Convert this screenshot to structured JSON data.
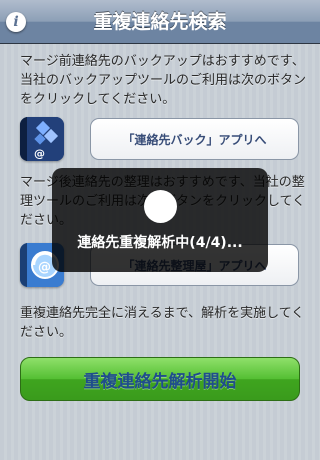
{
  "navbar": {
    "title": "重複連絡先検索",
    "info_glyph": "i"
  },
  "intro_text": "マージ前連絡先のバックアップはおすすめです、当社のバックアップツールのご利用は次のボタンをクリックしてください。",
  "backup_button_label": "「連絡先バック」アプリへ",
  "organize_text": "マージ後連絡先の整理はおすすめです、当社の整理ツールのご利用は次のボタンをクリックしてください。",
  "organize_button_label": "「連絡先整理屋」アプリへ",
  "run_text": "重複連絡先完全に消えるまで、解析を実施してください。",
  "start_button_label": "重複連絡先解析開始",
  "progress_overlay": {
    "message": "連絡先重複解析中(4/4)..."
  },
  "colors": {
    "navbar": "#6d84a2",
    "start_button": "#54bf33",
    "start_label": "#1f4d8c",
    "link_label": "#384d78"
  },
  "icons": {
    "info": "info-icon",
    "backup_app": "contacts-backup-app-icon",
    "organize_app": "contacts-organizer-app-icon",
    "spinner": "loading-spinner-icon"
  }
}
